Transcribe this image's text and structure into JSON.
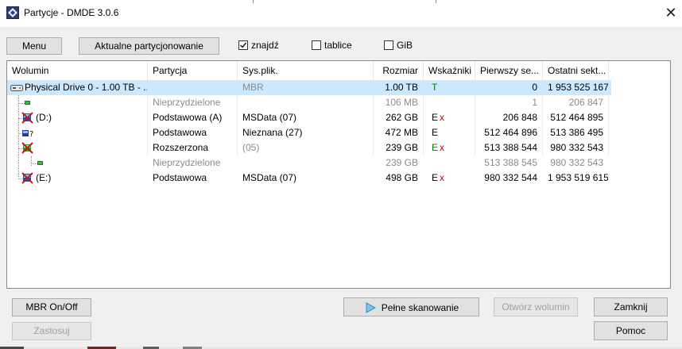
{
  "window": {
    "title": "Partycje - DMDE 3.0.6"
  },
  "toolbar": {
    "menu_label": "Menu",
    "current_partitioning_label": "Aktualne partycjonowanie",
    "checkboxes": [
      {
        "label": "znajdź",
        "checked": true
      },
      {
        "label": "tablice",
        "checked": false
      },
      {
        "label": "GiB",
        "checked": false
      }
    ]
  },
  "table": {
    "columns": [
      "Wolumin",
      "Partycja",
      "Sys.plik.",
      "Rozmiar",
      "Wskaźniki",
      "Pierwszy se...",
      "Ostatni sekt..."
    ],
    "rows": [
      {
        "volume": "Physical Drive 0 - 1.00 TB - ...",
        "partition": "",
        "fs": "MBR",
        "size": "1.00 TB",
        "flag_main": "T",
        "flag_x": "",
        "first": "0",
        "last": "1 953 525 167",
        "icon": "hard-drive-icon",
        "selected": true,
        "muted": false
      },
      {
        "volume": "",
        "partition": "Nieprzydzielone",
        "fs": "",
        "size": "106 MB",
        "flag_main": "",
        "flag_x": "",
        "first": "1",
        "last": "206 847",
        "icon": "unallocated-icon",
        "selected": false,
        "muted": true
      },
      {
        "volume": "(D:)",
        "partition": "Podstawowa (A)",
        "fs": "MSData (07)",
        "size": "262 GB",
        "flag_main": "E",
        "flag_x": "x",
        "first": "206 848",
        "last": "512 464 895",
        "icon": "volume-error-icon",
        "selected": false,
        "muted": false
      },
      {
        "volume": "",
        "partition": "Podstawowa",
        "fs": "Nieznana (27)",
        "size": "472 MB",
        "flag_main": "E",
        "flag_x": "",
        "first": "512 464 896",
        "last": "513 386 495",
        "icon": "unknown-volume-icon",
        "selected": false,
        "muted": false
      },
      {
        "volume": "",
        "partition": "Rozszerzona",
        "fs": "(05)",
        "size": "239 GB",
        "flag_main": "E",
        "flag_x": "x",
        "first": "513 388 544",
        "last": "980 332 543",
        "icon": "extended-partition-icon",
        "selected": false,
        "muted": false
      },
      {
        "volume": "",
        "partition": "Nieprzydzielone",
        "fs": "",
        "size": "239 GB",
        "flag_main": "",
        "flag_x": "",
        "first": "513 388 545",
        "last": "980 332 543",
        "icon": "unallocated-icon",
        "selected": false,
        "muted": true
      },
      {
        "volume": "(E:)",
        "partition": "Podstawowa",
        "fs": "MSData (07)",
        "size": "498 GB",
        "flag_main": "E",
        "flag_x": "x",
        "first": "980 332 544",
        "last": "1 953 519 615",
        "icon": "volume-error-icon",
        "selected": false,
        "muted": false
      }
    ]
  },
  "buttons": {
    "mbr_onoff": "MBR On/Off",
    "apply": "Zastosuj",
    "full_scan": "Pełne skanowanie",
    "open_volume": "Otwórz wolumin",
    "close": "Zamknij",
    "help": "Pomoc"
  },
  "colors": {
    "selection": "#cce8ff",
    "flag_green": "#008000",
    "flag_red": "#c00000",
    "muted_text": "#8c8c8c"
  }
}
